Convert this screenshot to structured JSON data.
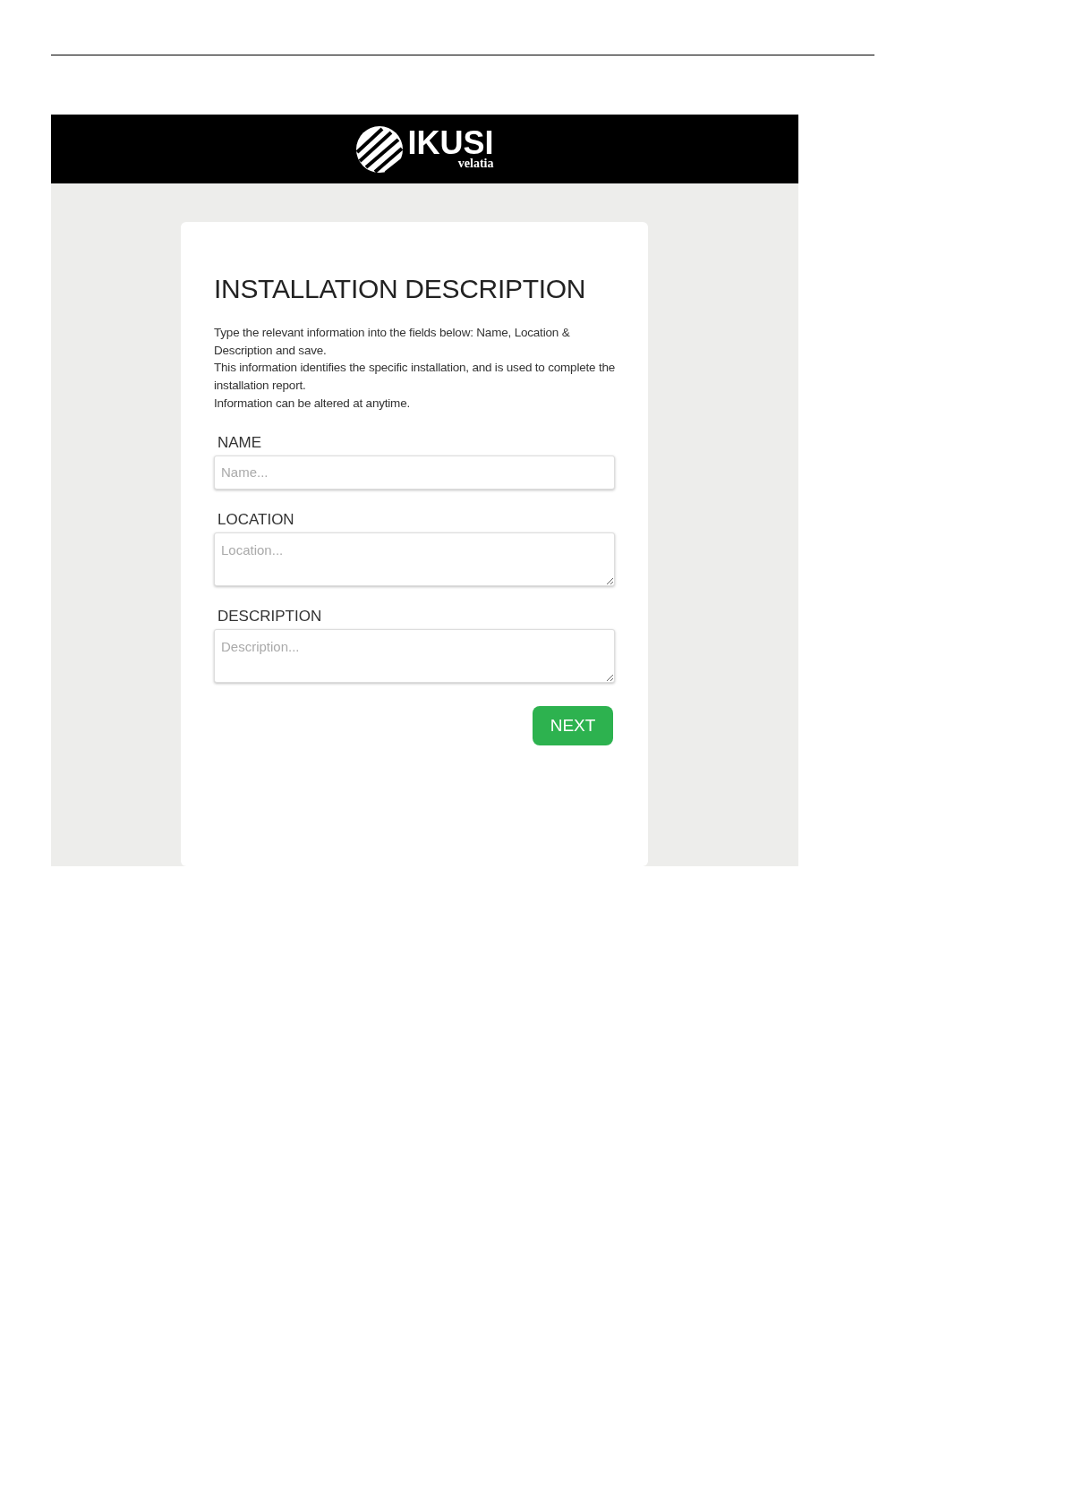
{
  "header": {
    "logo_text": "IKUSI",
    "logo_subtext": "velatia"
  },
  "form": {
    "title": "INSTALLATION DESCRIPTION",
    "instructions": [
      "Type the relevant information into the fields below: Name, Location & Description and save.",
      "This information identifies the specific installation, and is used to complete the installation report.",
      "Information can be altered at anytime."
    ],
    "fields": [
      {
        "label": "NAME",
        "placeholder": "Name...",
        "kind": "input"
      },
      {
        "label": "LOCATION",
        "placeholder": "Location...",
        "kind": "textarea"
      },
      {
        "label": "DESCRIPTION",
        "placeholder": "Description...",
        "kind": "textarea"
      }
    ],
    "button": "NEXT"
  }
}
